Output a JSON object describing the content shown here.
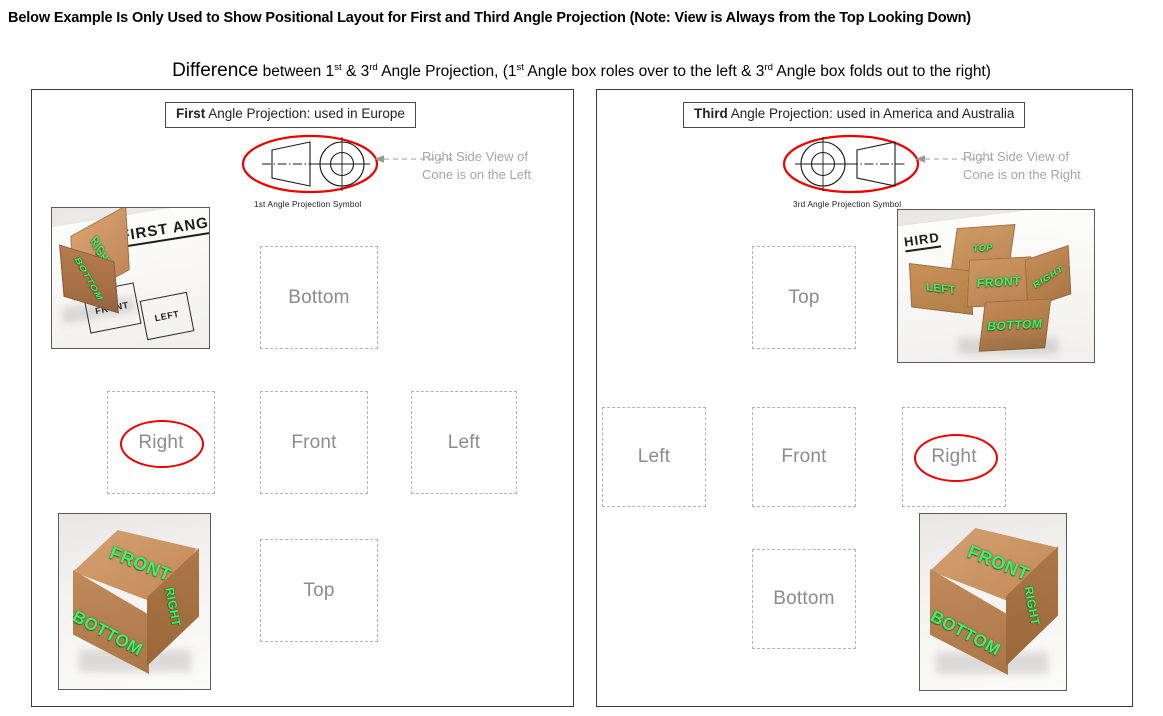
{
  "headings": {
    "main": "Below Example Is Only Used to Show Positional Layout for First and Third Angle Projection (Note: View is Always from the Top Looking Down)",
    "sub_lead": "Difference",
    "sub_rest_a": " between 1",
    "sub_sup_1": "st",
    "sub_rest_b": " & 3",
    "sub_sup_3": "rd",
    "sub_rest_c": " Angle Projection, (1",
    "sub_sup_1b": "st",
    "sub_rest_d": " Angle box roles over to the left & 3",
    "sub_sup_3b": "rd",
    "sub_rest_e": " Angle box folds out to the right)"
  },
  "colors": {
    "highlight_red": "#ee0000",
    "cell_border": "#b3b3b3",
    "cell_text": "#8c8c8c",
    "leader_text": "#a6a6a6",
    "face_green": "#3ff06b",
    "cardboard": "#c08a5a"
  },
  "first_angle": {
    "title_bold": "First",
    "title_rest": " Angle Projection: used in Europe",
    "symbol_caption": "1st Angle Projection Symbol",
    "symbol_order": "cone-left-circles-right",
    "leader_line_1": "Right Side View of",
    "leader_line_2": "Cone is on the Left",
    "cells": [
      {
        "label": "Bottom",
        "row": 1,
        "col": 2,
        "circled": false
      },
      {
        "label": "Right",
        "row": 2,
        "col": 1,
        "circled": true
      },
      {
        "label": "Front",
        "row": 2,
        "col": 2,
        "circled": false
      },
      {
        "label": "Left",
        "row": 2,
        "col": 3,
        "circled": false
      },
      {
        "label": "Top",
        "row": 3,
        "col": 2,
        "circled": false
      }
    ],
    "photo_top": {
      "paper_text": "FIRST ANG",
      "box_faces": [
        "RIGHT",
        "BOTTOM"
      ],
      "outline_boxes": [
        "FRONT",
        "LEFT"
      ]
    },
    "photo_bottom": {
      "box_faces": [
        "FRONT",
        "BOTTOM",
        "RIGHT"
      ]
    }
  },
  "third_angle": {
    "title_bold": "Third",
    "title_rest": " Angle Projection: used in America and Australia",
    "symbol_caption": "3rd Angle Projection Symbol",
    "symbol_order": "circles-left-cone-right",
    "leader_line_1": "Right Side View of",
    "leader_line_2": "Cone is on the Right",
    "cells": [
      {
        "label": "Top",
        "row": 1,
        "col": 2,
        "circled": false
      },
      {
        "label": "Left",
        "row": 2,
        "col": 1,
        "circled": false
      },
      {
        "label": "Front",
        "row": 2,
        "col": 2,
        "circled": false
      },
      {
        "label": "Right",
        "row": 2,
        "col": 3,
        "circled": true
      },
      {
        "label": "Bottom",
        "row": 3,
        "col": 2,
        "circled": false
      }
    ],
    "photo_top": {
      "paper_text": "HIRD",
      "box_faces": [
        "TOP",
        "LEFT",
        "FRONT",
        "RIGHT",
        "BOTTOM"
      ]
    },
    "photo_bottom": {
      "box_faces": [
        "FRONT",
        "BOTTOM",
        "RIGHT"
      ]
    }
  }
}
